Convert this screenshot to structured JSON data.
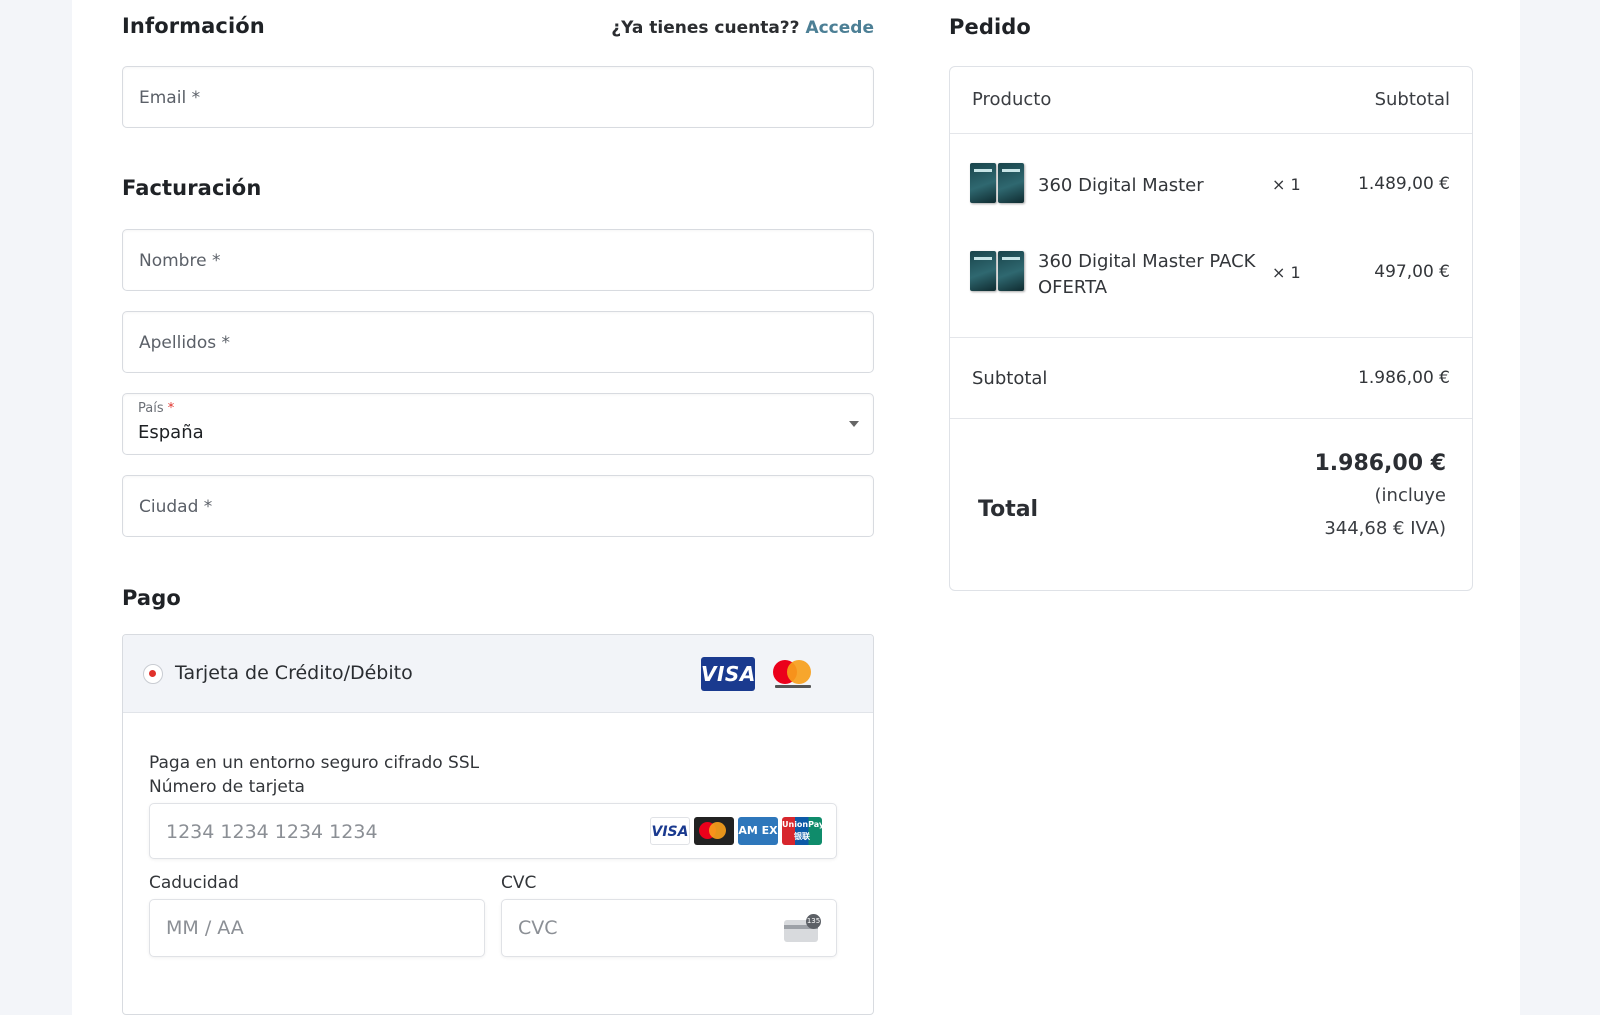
{
  "informacion": {
    "title": "Información",
    "login_prompt": "¿Ya tienes cuenta??",
    "login_link": "Accede",
    "email_placeholder": "Email *"
  },
  "facturacion": {
    "title": "Facturación",
    "nombre_placeholder": "Nombre *",
    "apellidos_placeholder": "Apellidos *",
    "pais_label": "País",
    "pais_required": "*",
    "pais_value": "España",
    "ciudad_placeholder": "Ciudad *"
  },
  "pago": {
    "title": "Pago",
    "method_label": "Tarjeta de Crédito/Débito",
    "visa_text": "VISA",
    "secure_text": "Paga en un entorno seguro cifrado SSL",
    "card_number_label": "Número de tarjeta",
    "card_number_placeholder": "1234 1234 1234 1234",
    "brands": {
      "visa": "VISA",
      "amex": "AM EX",
      "unionpay": "UnionPay 银联"
    },
    "expiry_label": "Caducidad",
    "expiry_placeholder": "MM / AA",
    "cvc_label": "CVC",
    "cvc_placeholder": "CVC",
    "cvc_icon_text": "135"
  },
  "pedido": {
    "title": "Pedido",
    "col_product": "Producto",
    "col_subtotal": "Subtotal",
    "items": [
      {
        "name": "360 Digital Master",
        "qty": "× 1",
        "price": "1.489,00 €"
      },
      {
        "name": "360 Digital Master PACK OFERTA",
        "qty": "× 1",
        "price": "497,00 €"
      }
    ],
    "subtotal_label": "Subtotal",
    "subtotal_value": "1.986,00 €",
    "total_label": "Total",
    "total_value": "1.986,00 €",
    "tax_line1": "(incluye",
    "tax_line2": "344,68 € IVA)"
  },
  "colors": {
    "accent_link": "#4c7f95",
    "required": "#e0312b",
    "visa_blue": "#1a3a8f"
  }
}
